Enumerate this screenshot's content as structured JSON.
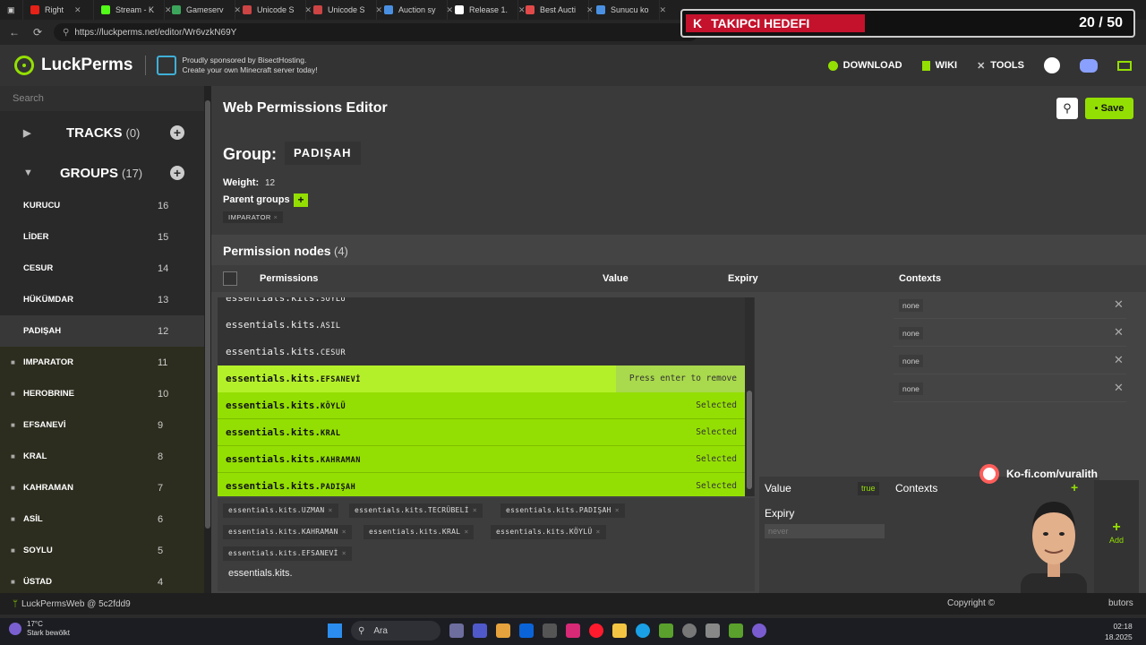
{
  "browser": {
    "tabs": [
      {
        "label": "Right",
        "color": "#e62117"
      },
      {
        "label": "Stream - K",
        "color": "#53fc18"
      },
      {
        "label": "Gameserv",
        "color": "#3ca55c"
      },
      {
        "label": "Unicode S",
        "color": "#c44"
      },
      {
        "label": "Unicode S",
        "color": "#c44"
      },
      {
        "label": "Auction sy",
        "color": "#4a90e2"
      },
      {
        "label": "Release 1.",
        "color": "#ffffff"
      },
      {
        "label": "Best Aucti",
        "color": "#e24a4a"
      },
      {
        "label": "Sunucu ko",
        "color": "#4a90e2"
      }
    ],
    "url": "https://luckperms.net/editor/Wr6vzkN69Y"
  },
  "goal": {
    "k": "K",
    "label": "TAKIPCI HEDEFI",
    "count": "20 / 50",
    "progress": 0.4
  },
  "header": {
    "logo": "LuckPerms",
    "sponsor_line1": "Proudly sponsored by BisectHosting.",
    "sponsor_line2": "Create your own Minecraft server today!",
    "nav": {
      "download": "DOWNLOAD",
      "wiki": "WIKI",
      "tools": "TOOLS"
    }
  },
  "sidebar": {
    "search_placeholder": "Search",
    "tracks_label": "TRACKS",
    "tracks_count": "(0)",
    "groups_label": "GROUPS",
    "groups_count": "(17)",
    "groups": [
      {
        "name": "KURUCU",
        "weight": "16"
      },
      {
        "name": "LİDER",
        "weight": "15"
      },
      {
        "name": "CESUR",
        "weight": "14"
      },
      {
        "name": "HÜKÜMDAR",
        "weight": "13"
      },
      {
        "name": "PADIŞAH",
        "weight": "12"
      },
      {
        "name": "IMPARATOR",
        "weight": "11"
      },
      {
        "name": "HEROBRINE",
        "weight": "10"
      },
      {
        "name": "EFSANEVİ",
        "weight": "9"
      },
      {
        "name": "KRAL",
        "weight": "8"
      },
      {
        "name": "KAHRAMAN",
        "weight": "7"
      },
      {
        "name": "ASİL",
        "weight": "6"
      },
      {
        "name": "SOYLU",
        "weight": "5"
      },
      {
        "name": "ÜSTAD",
        "weight": "4"
      }
    ],
    "footer": "LuckPermsWeb @ 5c2fdd9"
  },
  "main": {
    "title": "Web Permissions Editor",
    "save_label": "Save",
    "group_label": "Group:",
    "group_name": "PADIŞAH",
    "weight_label": "Weight:",
    "weight_value": "12",
    "parent_label": "Parent groups",
    "parent_chip": "IMPARATOR",
    "nodes_title": "Permission nodes",
    "nodes_count": "(4)",
    "columns": {
      "permissions": "Permissions",
      "value": "Value",
      "expiry": "Expiry",
      "contexts": "Contexts"
    },
    "context_rows": [
      "none",
      "none",
      "none",
      "none"
    ]
  },
  "dropdown": {
    "items": [
      {
        "prefix": "essentials.kits.",
        "suffix": "SOYLU",
        "state": "normal",
        "tag": ""
      },
      {
        "prefix": "essentials.kits.",
        "suffix": "ASIL",
        "state": "normal",
        "tag": ""
      },
      {
        "prefix": "essentials.kits.",
        "suffix": "CESUR",
        "state": "normal",
        "tag": ""
      },
      {
        "prefix": "essentials.kits.",
        "suffix": "EFSANEVİ",
        "state": "hover",
        "tag": "Press enter to remove"
      },
      {
        "prefix": "essentials.kits.",
        "suffix": "KÖYLÜ",
        "state": "sel",
        "tag": "Selected"
      },
      {
        "prefix": "essentials.kits.",
        "suffix": "KRAL",
        "state": "sel",
        "tag": "Selected"
      },
      {
        "prefix": "essentials.kits.",
        "suffix": "KAHRAMAN",
        "state": "sel",
        "tag": "Selected"
      },
      {
        "prefix": "essentials.kits.",
        "suffix": "PADIŞAH",
        "state": "sel",
        "tag": "Selected"
      }
    ]
  },
  "input": {
    "chips": [
      "essentials.kits.UZMAN",
      "essentials.kits.TECRÜBELİ",
      "essentials.kits.PADIŞAH",
      "essentials.kits.KAHRAMAN",
      "essentials.kits.KRAL",
      "essentials.kits.KÖYLÜ",
      "essentials.kits.EFSANEVİ"
    ],
    "typed": "essentials.kits."
  },
  "editor": {
    "value_label": "Value",
    "value_chip": "true",
    "contexts_label": "Contexts",
    "expiry_label": "Expiry",
    "expiry_placeholder": "never",
    "add_label": "Add"
  },
  "overlay": {
    "kofi": "Ko-fi.com/vuralith"
  },
  "footer": {
    "copyright": "Copyright ©",
    "contributors": "butors"
  },
  "taskbar": {
    "temp": "17°C",
    "weather": "Stark bewölkt",
    "search": "Ara",
    "time": "02:18",
    "date": "18.2025"
  }
}
